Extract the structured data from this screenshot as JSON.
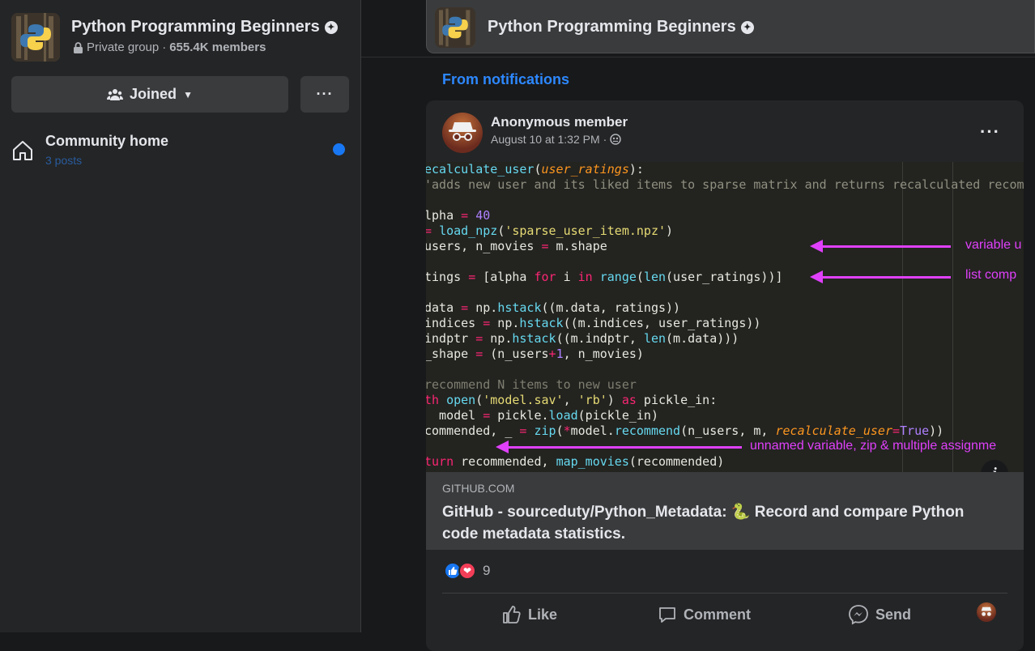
{
  "group": {
    "name": "Python Programming Beginners",
    "privacy": "Private group",
    "members": "655.4K members",
    "joined_label": "Joined",
    "more_label": "···"
  },
  "sidebar": {
    "community_home": "Community home",
    "community_posts": "3 posts"
  },
  "feed": {
    "from_notifications": "From notifications"
  },
  "post": {
    "author": "Anonymous member",
    "timestamp": "August 10 at 1:32 PM",
    "separator": "·",
    "menu_label": "···",
    "info_label": "i",
    "link_domain": "GITHUB.COM",
    "link_title": "GitHub - sourceduty/Python_Metadata: 🐍 Record and compare Python code metadata statistics.",
    "reaction_count": "9",
    "actions": {
      "like": "Like",
      "comment": "Comment",
      "send": "Send"
    }
  },
  "code_image": {
    "lines": [
      "ecalculate_user(user_ratings):",
      "'adds new user and its liked items to sparse matrix and returns recalculated recomm",
      "",
      "lpha = 40",
      "= load_npz('sparse_user_item.npz')",
      "users, n_movies = m.shape",
      "",
      "tings = [alpha for i in range(len(user_ratings))]",
      "",
      "data = np.hstack((m.data, ratings))",
      "indices = np.hstack((m.indices, user_ratings))",
      "indptr = np.hstack((m.indptr, len(m.data)))",
      "_shape = (n_users+1, n_movies)",
      "",
      "recommend N items to new user",
      "th open('model.sav', 'rb') as pickle_in:",
      "  model = pickle.load(pickle_in)",
      "commended, _ = zip(*model.recommend(n_users, m, recalculate_user=True))",
      "",
      "turn recommended, map_movies(recommended)"
    ],
    "annotations": {
      "a1": "variable u",
      "a2": "list comp",
      "a3": "unnamed variable, zip & multiple assignme"
    }
  },
  "colors": {
    "accent": "#2d88ff",
    "background": "#18191a",
    "surface": "#242526",
    "annotation": "#e040fb"
  }
}
